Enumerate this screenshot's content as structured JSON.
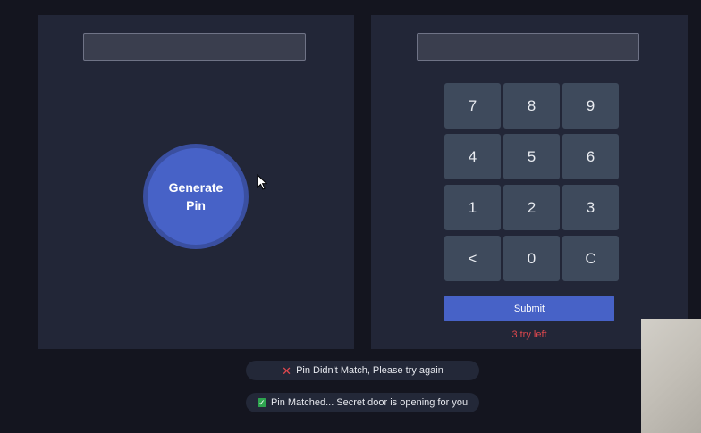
{
  "generator": {
    "pin_display": "",
    "generate_button_label": "Generate Pin"
  },
  "verifier": {
    "input_display": "",
    "keypad": [
      "7",
      "8",
      "9",
      "4",
      "5",
      "6",
      "1",
      "2",
      "3",
      "<",
      "0",
      "C"
    ],
    "submit_label": "Submit",
    "tries_left_text": "3 try left"
  },
  "notifications": {
    "fail_icon": "x-mark-icon",
    "fail_text": "Pin Didn't Match, Please try again",
    "success_icon": "green-check-icon",
    "success_text": "Pin Matched... Secret door is opening for you"
  },
  "colors": {
    "background": "#14151f",
    "panel": "#222637",
    "accent": "#4762c7",
    "key": "#3e4a5c",
    "error": "#e0484e",
    "success": "#2ea44f"
  }
}
